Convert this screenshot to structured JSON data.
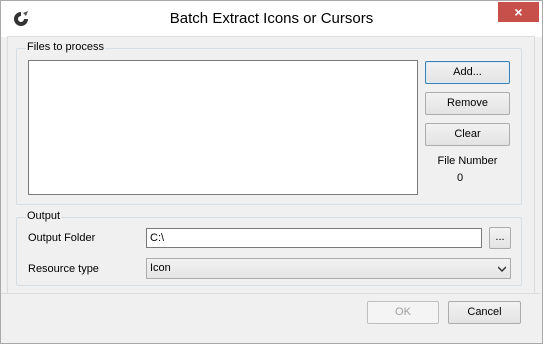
{
  "window": {
    "title": "Batch Extract Icons or Cursors",
    "close_glyph": "×",
    "app_icon": "app-icon"
  },
  "files_group": {
    "legend": "Files to process",
    "add_label": "Add...",
    "remove_label": "Remove",
    "clear_label": "Clear",
    "file_number_label": "File Number",
    "file_number_value": "0"
  },
  "output_group": {
    "legend": "Output",
    "output_folder_label": "Output Folder",
    "output_folder_value": "C:\\",
    "browse_label": "...",
    "resource_type_label": "Resource type",
    "resource_type_value": "Icon"
  },
  "footer": {
    "ok_label": "OK",
    "cancel_label": "Cancel"
  },
  "colors": {
    "close_button": "#c7504a",
    "default_button_border": "#3c7fb1"
  }
}
